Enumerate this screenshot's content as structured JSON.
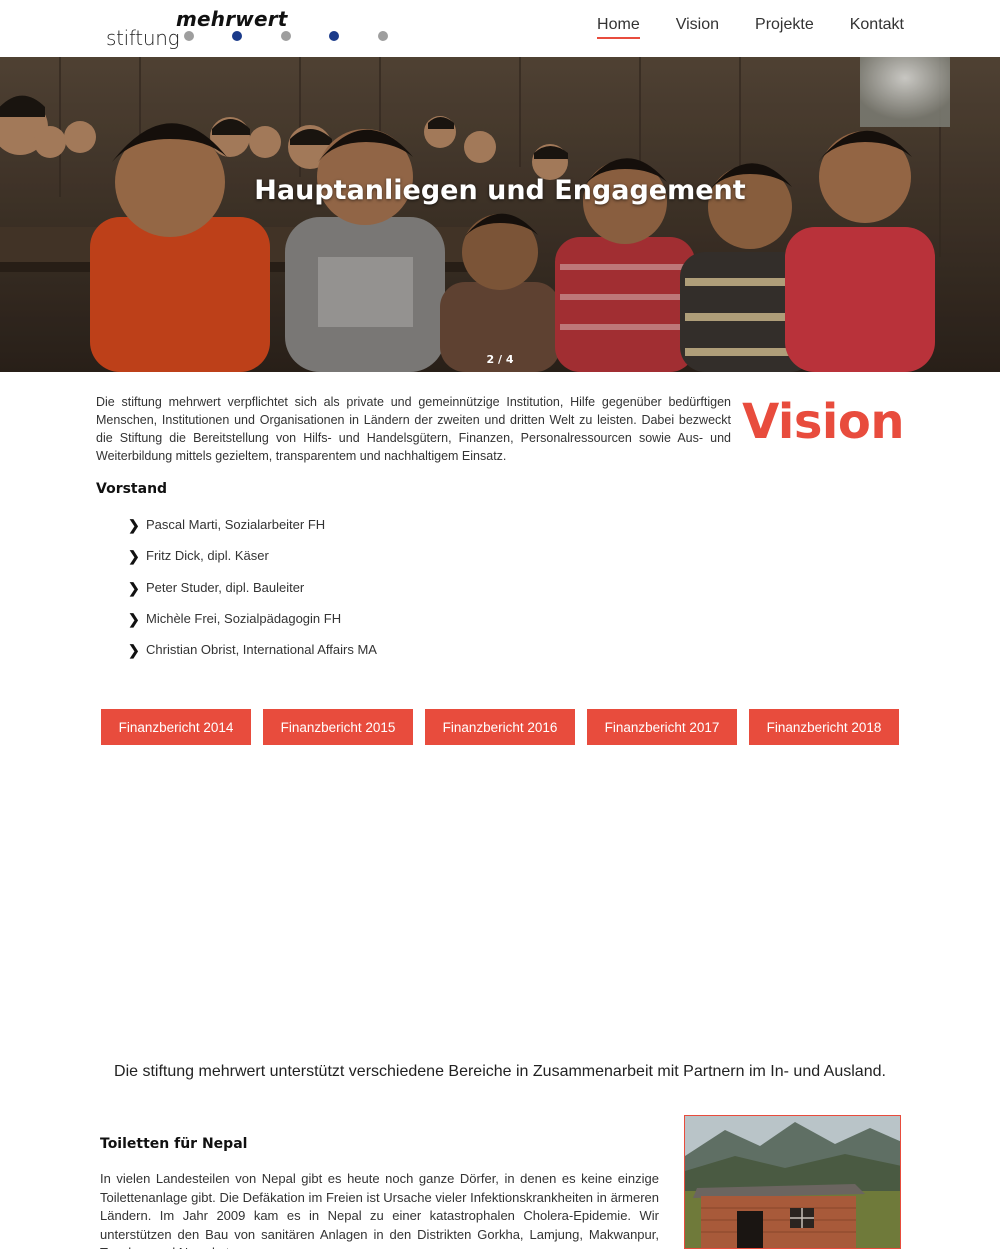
{
  "brand": {
    "word1": "stiftung",
    "word2": "mehrwert",
    "dot_colors": [
      "#9e9e9e",
      "#1a3a8a",
      "#9e9e9e",
      "#1a3a8a",
      "#9e9e9e"
    ]
  },
  "nav": {
    "items": [
      {
        "label": "Home",
        "active": true
      },
      {
        "label": "Vision",
        "active": false
      },
      {
        "label": "Projekte",
        "active": false
      },
      {
        "label": "Kontakt",
        "active": false
      }
    ]
  },
  "hero": {
    "title": "Hauptanliegen und Engagement",
    "counter": "2 / 4"
  },
  "vision": {
    "intro": "Die stiftung mehrwert verpflichtet sich als private und gemeinnützige Institution, Hilfe gegenüber bedürftigen Menschen, Institutionen und Organisationen in Ländern der zweiten und dritten Welt zu leisten. Dabei bezweckt die Stiftung die Bereitstellung von Hilfs- und Handelsgütern, Finanzen, Personalressourcen sowie Aus- und Weiterbildung mittels gezieltem, transparentem und nachhaltigem Einsatz.",
    "heading": "Vision",
    "board_title": "Vorstand",
    "board": [
      "Pascal Marti, Sozialarbeiter FH",
      "Fritz Dick, dipl. Käser",
      "Peter Studer, dipl. Bauleiter",
      "Michèle Frei, Sozialpädagogin FH",
      "Christian Obrist, International Affairs MA"
    ],
    "reports": [
      "Finanzbericht 2014",
      "Finanzbericht 2015",
      "Finanzbericht 2016",
      "Finanzbericht 2017",
      "Finanzbericht 2018"
    ]
  },
  "support_text": "Die stiftung mehrwert unterstützt verschiedene Bereiche in Zusammenarbeit mit Partnern im In- und Ausland.",
  "project": {
    "title": "Toiletten für Nepal",
    "text": "In vielen Landesteilen von Nepal gibt es heute noch ganze Dörfer, in denen es keine einzige Toilettenanlage gibt. Die Defäkation im Freien ist Ursache vieler Infektionskrankheiten in ärmeren Ländern. Im Jahr 2009 kam es in Nepal zu einer katastrophalen Cholera-Epidemie. Wir unterstützen den Bau von sanitären Anlagen in den Distrikten Gorkha, Lamjung, Makwanpur, Tanahun und Nuwakot."
  },
  "colors": {
    "accent": "#e84c3d"
  }
}
